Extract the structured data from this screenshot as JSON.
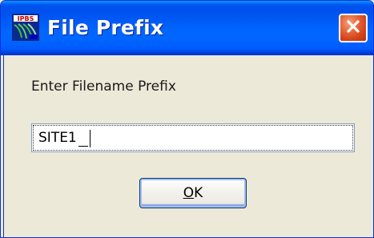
{
  "window": {
    "title": "File Prefix",
    "app_icon": "ipbs-app-icon",
    "close_icon": "close-icon",
    "colors": {
      "titlebar": "#0055ea",
      "close_button": "#d9481f",
      "client_bg": "#ece9d8"
    }
  },
  "dialog": {
    "prompt": "Enter Filename Prefix",
    "input": {
      "value": "SITE1"
    },
    "ok_button": {
      "mnemonic": "O",
      "rest": "K"
    }
  }
}
